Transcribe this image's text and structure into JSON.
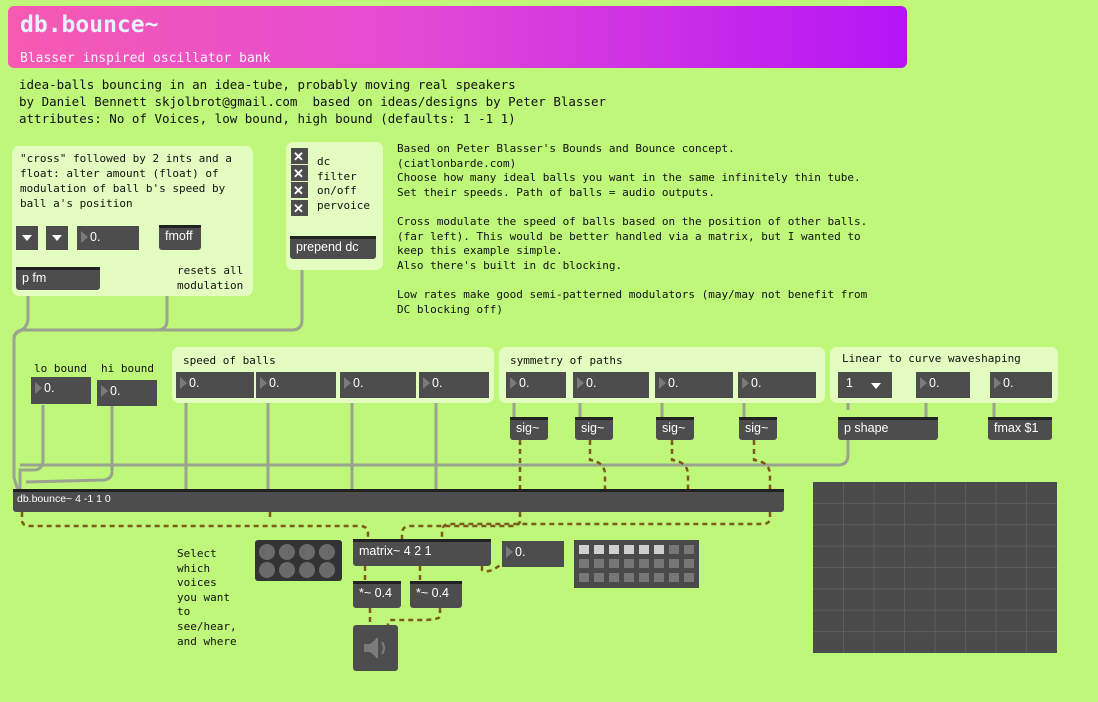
{
  "header": {
    "title": "db.bounce~",
    "subtitle": "Blasser inspired oscillator bank"
  },
  "description": {
    "line1": "idea-balls bouncing in an idea-tube, probably moving real speakers",
    "line2": "by Daniel Bennett skjolbrot@gmail.com  based on ideas/designs by Peter Blasser",
    "line3": "attributes: No of Voices, low bound, high bound (defaults: 1 -1 1)"
  },
  "cross_panel": {
    "comment": "\"cross\" followed by 2 ints and a\nfloat: alter amount (float) of\nmodulation of ball b's speed by\nball a's position",
    "number_value": "0.",
    "fmoff_label": "fmoff",
    "pfm_label": "p fm",
    "resets_comment": "resets all\nmodulation"
  },
  "toggle_panel": {
    "toggles": [
      {
        "label": "dc",
        "checked": true
      },
      {
        "label": "filter",
        "checked": true
      },
      {
        "label": "on/off",
        "checked": true
      },
      {
        "label": "pervoice",
        "checked": true
      }
    ],
    "prepend_label": "prepend dc"
  },
  "info_comment": "Based on Peter Blasser's Bounds and Bounce concept.\n(ciatlonbarde.com)\nChoose how many ideal balls you want in the same infinitely thin tube.\nSet their speeds. Path of balls = audio outputs.\n\nCross modulate the speed of balls based on the position of other balls.\n(far left). This would be better handled via a matrix, but I wanted to\nkeep this example simple.\nAlso there's built in dc blocking.\n\nLow rates make good semi-patterned modulators (may/may not benefit from\nDC blocking off)",
  "bounds": {
    "lo_label": "lo bound",
    "hi_label": "hi bound",
    "lo_value": "0.",
    "hi_value": "0."
  },
  "speed_panel": {
    "title": "speed of balls",
    "values": [
      "0.",
      "0.",
      "0.",
      "0."
    ]
  },
  "symmetry_panel": {
    "title": "symmetry of paths",
    "values": [
      "0.",
      "0.",
      "0.",
      "0."
    ],
    "sig_label": "sig~"
  },
  "shape_panel": {
    "title": "Linear to curve waveshaping",
    "menu_value": "1",
    "values": [
      "0.",
      "0."
    ],
    "pshape_label": "p shape",
    "fmax_label": "fmax $1"
  },
  "main_object": "db.bounce~ 4 -1 1 0",
  "bottom": {
    "select_comment": "Select\nwhich\nvoices\nyou want\nto\nsee/hear,\nand where",
    "matrix_label": "matrix~ 4 2 1",
    "matrix_number": "0.",
    "gain_left": "*~ 0.4",
    "gain_right": "*~ 0.4"
  },
  "colors": {
    "background": "#bff77a",
    "panel": "#e2fdbf",
    "object": "#4d4d4d",
    "header_start": "#f65bb1",
    "header_end": "#b515f6"
  }
}
